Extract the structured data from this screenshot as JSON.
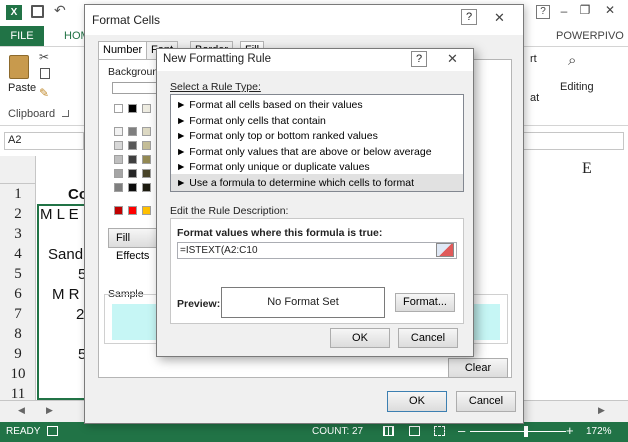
{
  "excel": {
    "file_tab": "FILE",
    "home_tab": "HOM",
    "powerpivot_tab": "POWERPIVO",
    "clipboard_group": "Clipboard",
    "paste_label": "Paste",
    "editing_label": "Editing",
    "ribbon_fragments": [
      "rt",
      "at"
    ],
    "name_box": "A2",
    "col_header_e": "E",
    "rows": [
      "1",
      "2",
      "3",
      "4",
      "5",
      "6",
      "7",
      "8",
      "9",
      "10",
      "11"
    ],
    "cells_a": [
      "Co",
      "M L E",
      "",
      "Sand",
      "5",
      "M R",
      "2",
      "",
      "5",
      "",
      ""
    ],
    "status_ready": "READY",
    "status_count": "COUNT: 27",
    "zoom": "172%",
    "window_min": "–",
    "window_restore": "❐",
    "window_close": "✕",
    "help": "?"
  },
  "format_cells": {
    "title": "Format Cells",
    "help": "?",
    "close": "✕",
    "tabs": [
      "Number",
      "Font",
      "Border",
      "Fill"
    ],
    "background_label": "Backgroun",
    "fill_effects_btn": "Fill Effects",
    "sample_label": "Sample",
    "clear_btn": "Clear",
    "ok_btn": "OK",
    "cancel_btn": "Cancel"
  },
  "new_rule": {
    "title": "New Formatting Rule",
    "help": "?",
    "close": "✕",
    "select_rule_type_label": "Select a Rule Type:",
    "rule_types": [
      "► Format all cells based on their values",
      "► Format only cells that contain",
      "► Format only top or bottom ranked values",
      "► Format only values that are above or below average",
      "► Format only unique or duplicate values",
      "► Use a formula to determine which cells to format"
    ],
    "selected_rule_index": 5,
    "edit_desc_label": "Edit the Rule Description:",
    "formula_label": "Format values where this formula is true:",
    "formula_value": "=ISTEXT(A2:C10",
    "preview_label": "Preview:",
    "preview_text": "No Format Set",
    "format_btn": "Format...",
    "ok_btn": "OK",
    "cancel_btn": "Cancel"
  },
  "colors": {
    "excel_green": "#217346",
    "sample_fill": "#c6f6f5",
    "selected_rule_bg": "#e1e1e1"
  }
}
